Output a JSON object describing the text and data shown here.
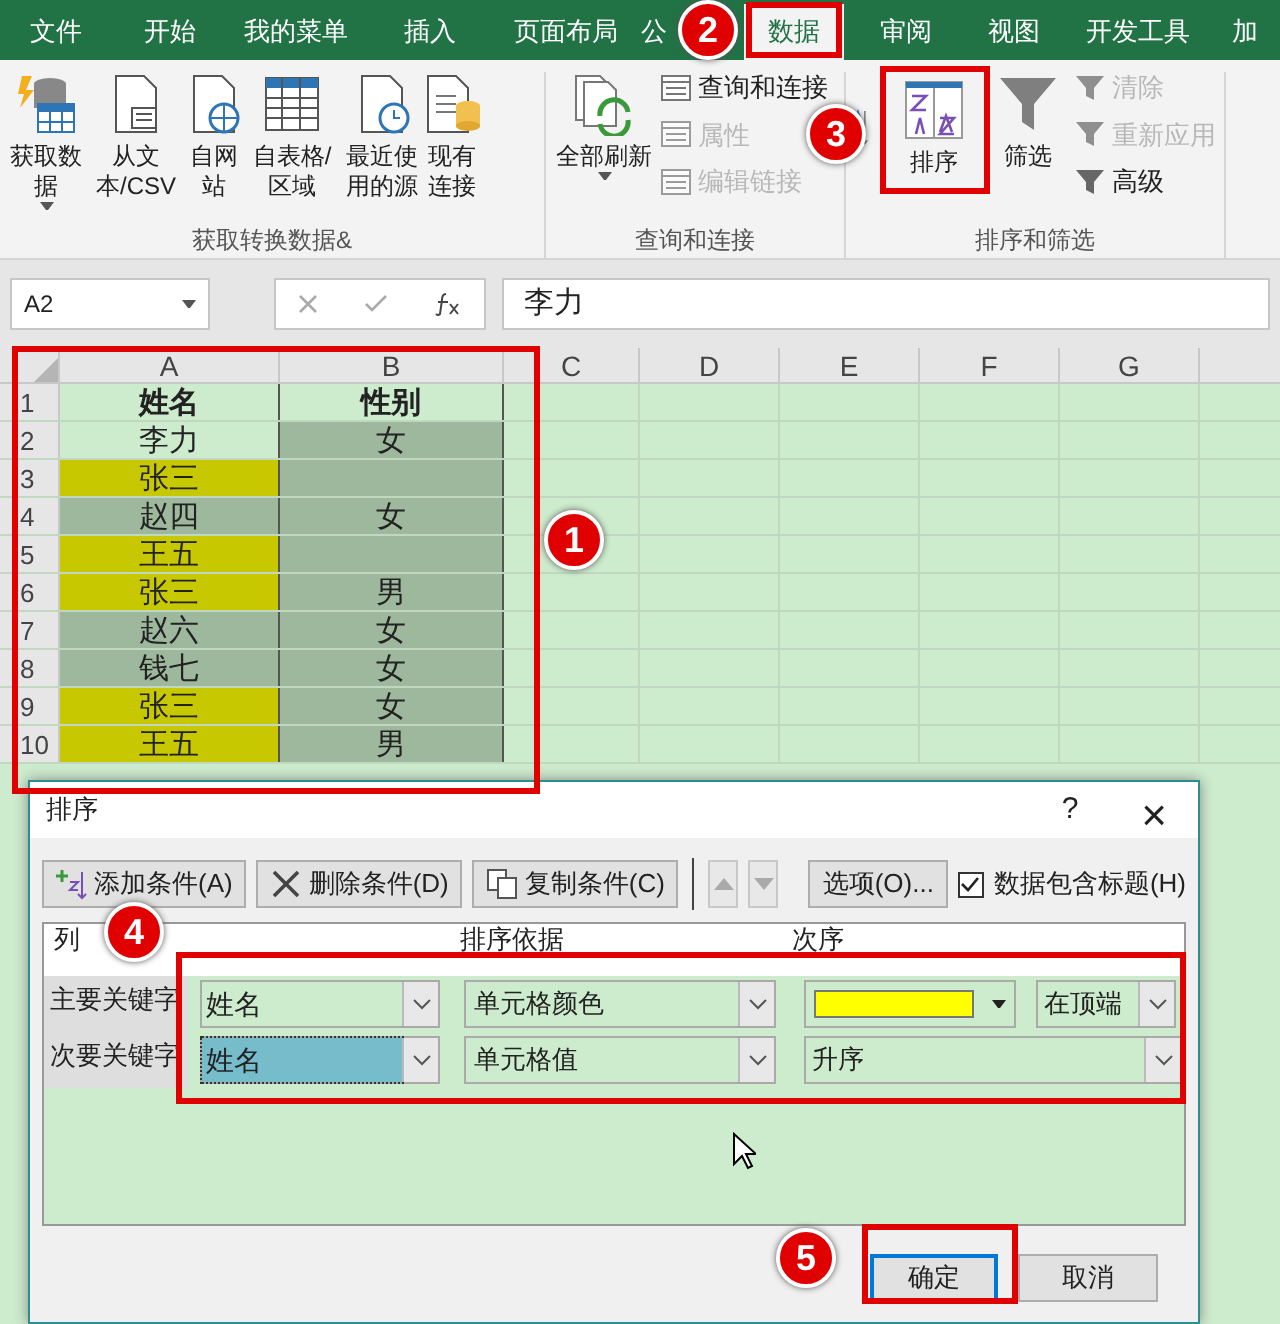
{
  "tabs": [
    {
      "label": "文件",
      "selected": false
    },
    {
      "label": "开始",
      "selected": false
    },
    {
      "label": "我的菜单",
      "selected": false
    },
    {
      "label": "插入",
      "selected": false
    },
    {
      "label": "页面布局",
      "selected": false
    },
    {
      "label": "公",
      "selected": false
    },
    {
      "label": "数据",
      "selected": true
    },
    {
      "label": "审阅",
      "selected": false
    },
    {
      "label": "视图",
      "selected": false
    },
    {
      "label": "开发工具",
      "selected": false
    },
    {
      "label": "加",
      "selected": false
    }
  ],
  "ribbon": {
    "groups": [
      {
        "title": "获取转换数据&",
        "large": [
          {
            "label": "获取数据",
            "caret": true
          },
          {
            "label": "从文本/CSV"
          },
          {
            "label": "自网站"
          },
          {
            "label": "自表格/区域"
          },
          {
            "label": "最近使用的源"
          },
          {
            "label": "现有连接"
          }
        ]
      },
      {
        "title": "查询和连接",
        "large": [
          {
            "label": "全部刷新",
            "caret": true
          }
        ],
        "small": [
          {
            "label": "查询和连接",
            "disabled": false
          },
          {
            "label": "属性",
            "disabled": true
          },
          {
            "label": "编辑链接",
            "disabled": true
          }
        ]
      },
      {
        "title": "排序和筛选",
        "large": [
          {
            "label": "排序"
          },
          {
            "label": "筛选"
          }
        ],
        "small": [
          {
            "label": "清除",
            "disabled": true
          },
          {
            "label": "重新应用",
            "disabled": true
          },
          {
            "label": "高级",
            "disabled": false
          }
        ]
      }
    ]
  },
  "formula_bar": {
    "name_box": "A2",
    "value": "李力"
  },
  "sheet": {
    "columns": [
      "A",
      "B",
      "C",
      "D",
      "E",
      "F",
      "G"
    ],
    "header": {
      "row": "1",
      "cells": [
        {
          "text": "姓名"
        },
        {
          "text": "性别"
        }
      ]
    },
    "rows": [
      {
        "row": "2",
        "cells": [
          {
            "text": "李力",
            "color": "#cdebcd"
          },
          {
            "text": "女",
            "color": "#9eb89e"
          }
        ]
      },
      {
        "row": "3",
        "cells": [
          {
            "text": "张三",
            "color": "#c8c800"
          },
          {
            "color": "#9eb89e"
          }
        ]
      },
      {
        "row": "4",
        "cells": [
          {
            "text": "赵四",
            "color": "#9eb89e"
          },
          {
            "text": "女",
            "color": "#9eb89e"
          }
        ]
      },
      {
        "row": "5",
        "cells": [
          {
            "text": "王五",
            "color": "#c8c800"
          },
          {
            "color": "#9eb89e"
          }
        ]
      },
      {
        "row": "6",
        "cells": [
          {
            "text": "张三",
            "color": "#c8c800"
          },
          {
            "text": "男",
            "color": "#9eb89e"
          }
        ]
      },
      {
        "row": "7",
        "cells": [
          {
            "text": "赵六",
            "color": "#9eb89e"
          },
          {
            "text": "女",
            "color": "#9eb89e"
          }
        ]
      },
      {
        "row": "8",
        "cells": [
          {
            "text": "钱七",
            "color": "#9eb89e"
          },
          {
            "text": "女",
            "color": "#9eb89e"
          }
        ]
      },
      {
        "row": "9",
        "cells": [
          {
            "text": "张三",
            "color": "#c8c800"
          },
          {
            "text": "女",
            "color": "#9eb89e"
          }
        ]
      },
      {
        "row": "10",
        "cells": [
          {
            "text": "王五",
            "color": "#c8c800"
          },
          {
            "text": "男",
            "color": "#9eb89e"
          }
        ]
      }
    ]
  },
  "dialog": {
    "title": "排序",
    "help": "?",
    "close": "×",
    "toolbar": [
      "添加条件(A)",
      "删除条件(D)",
      "复制条件(C)"
    ],
    "move_buttons": [
      {
        "disabled": true
      },
      {
        "disabled": true
      }
    ],
    "options_button": "选项(O)...",
    "header_checkbox": {
      "label": "数据包含标题(H)",
      "checked": true
    },
    "columns": [
      "列",
      "排序依据",
      "次序"
    ],
    "levels": [
      {
        "label": "主要关键字",
        "column": "姓名",
        "selected": false,
        "sort_on": "单元格颜色",
        "kind": "color",
        "color": "#ffff00",
        "position": "在顶端"
      },
      {
        "label": "次要关键字",
        "column": "姓名",
        "selected": true,
        "sort_on": "单元格值",
        "kind": "text",
        "order": "升序"
      }
    ],
    "ok": "确定",
    "cancel": "取消"
  },
  "annotations": [
    {
      "number": "1"
    },
    {
      "number": "2"
    },
    {
      "number": "3"
    },
    {
      "number": "4"
    },
    {
      "number": "5"
    }
  ]
}
